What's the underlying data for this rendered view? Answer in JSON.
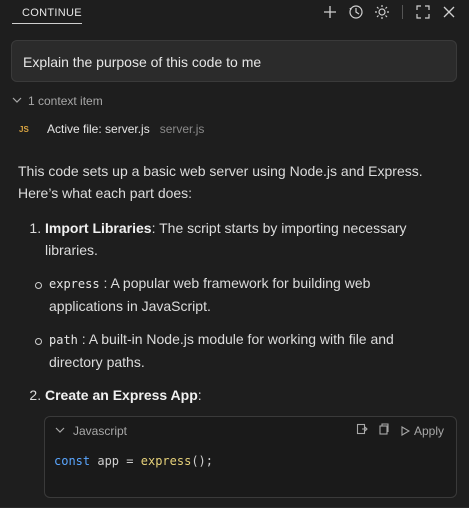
{
  "header": {
    "tab_label": "CONTINUE",
    "icons": [
      "plus-icon",
      "history-icon",
      "gear-icon",
      "divider",
      "fullscreen-icon",
      "close-icon"
    ]
  },
  "prompt": {
    "text": "Explain the purpose of this code to me"
  },
  "context": {
    "toggle_label": "1 context item",
    "file": {
      "badge": "JS",
      "active_label": "Active file: server.js",
      "name": "server.js"
    }
  },
  "response": {
    "intro": "This code sets up a basic web server using Node.js and Express. Here’s what each part does:",
    "items": [
      {
        "number": "1.",
        "title": "Import Libraries",
        "text": ": The script starts by importing necessary libraries.",
        "bullets": [
          {
            "code": "express",
            "text": " : A popular web framework for building web applications in JavaScript."
          },
          {
            "code": "path",
            "text": " : A built-in Node.js module for working with file and directory paths."
          }
        ]
      },
      {
        "number": "2.",
        "title": "Create an Express App",
        "text": ":"
      }
    ]
  },
  "codeblock": {
    "language": "Javascript",
    "apply_label": "Apply",
    "line_kw": "const",
    "line_var": "app",
    "line_eq": "=",
    "line_fn": "express",
    "line_end": "();"
  },
  "colors": {
    "background": "#1e1e1e",
    "keyword": "#5aa6ff",
    "function": "#e6d17a",
    "js_badge": "#d9a441"
  }
}
